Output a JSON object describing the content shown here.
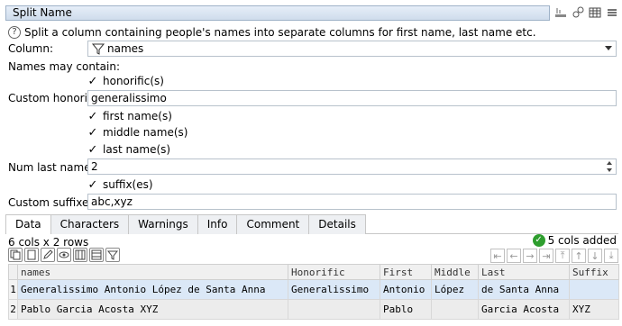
{
  "window": {
    "title": "Split Name"
  },
  "title_icons": [
    "toolbar-icon",
    "plugin-icon",
    "grid-icon",
    "menu-icon"
  ],
  "help_text": "Split a column containing people's names into separate columns for first name, last name etc.",
  "form": {
    "column_label": "Column:",
    "column_value": "names",
    "names_may_contain_label": "Names may contain:",
    "honorific_label": "honorific(s)",
    "custom_honorifics_label": "Custom honorifics:",
    "custom_honorifics_value": "generalissimo",
    "first_name_label": "first name(s)",
    "middle_name_label": "middle name(s)",
    "last_name_label": "last name(s)",
    "num_last_names_label": "Num last name(s):",
    "num_last_names_value": "2",
    "suffix_label": "suffix(es)",
    "custom_suffixes_label": "Custom suffixes:",
    "custom_suffixes_value": "abc,xyz"
  },
  "tabs": [
    "Data",
    "Characters",
    "Warnings",
    "Info",
    "Comment",
    "Details"
  ],
  "data_info": "6 cols x 2 rows",
  "status": "5 cols added",
  "table": {
    "headers": [
      "names",
      "Honorific",
      "First",
      "Middle",
      "Last",
      "Suffix"
    ],
    "rows": [
      {
        "num": "1",
        "cells": [
          "Generalissimo Antonio López de Santa Anna",
          "Generalissimo",
          "Antonio",
          "López",
          "de Santa Anna",
          ""
        ]
      },
      {
        "num": "2",
        "cells": [
          "Pablo Garcia Acosta XYZ",
          "",
          "Pablo",
          "",
          "Garcia Acosta",
          "XYZ"
        ]
      }
    ]
  },
  "colors": {
    "accent": "#2e9e2e",
    "selection": "#dbe8f7"
  }
}
